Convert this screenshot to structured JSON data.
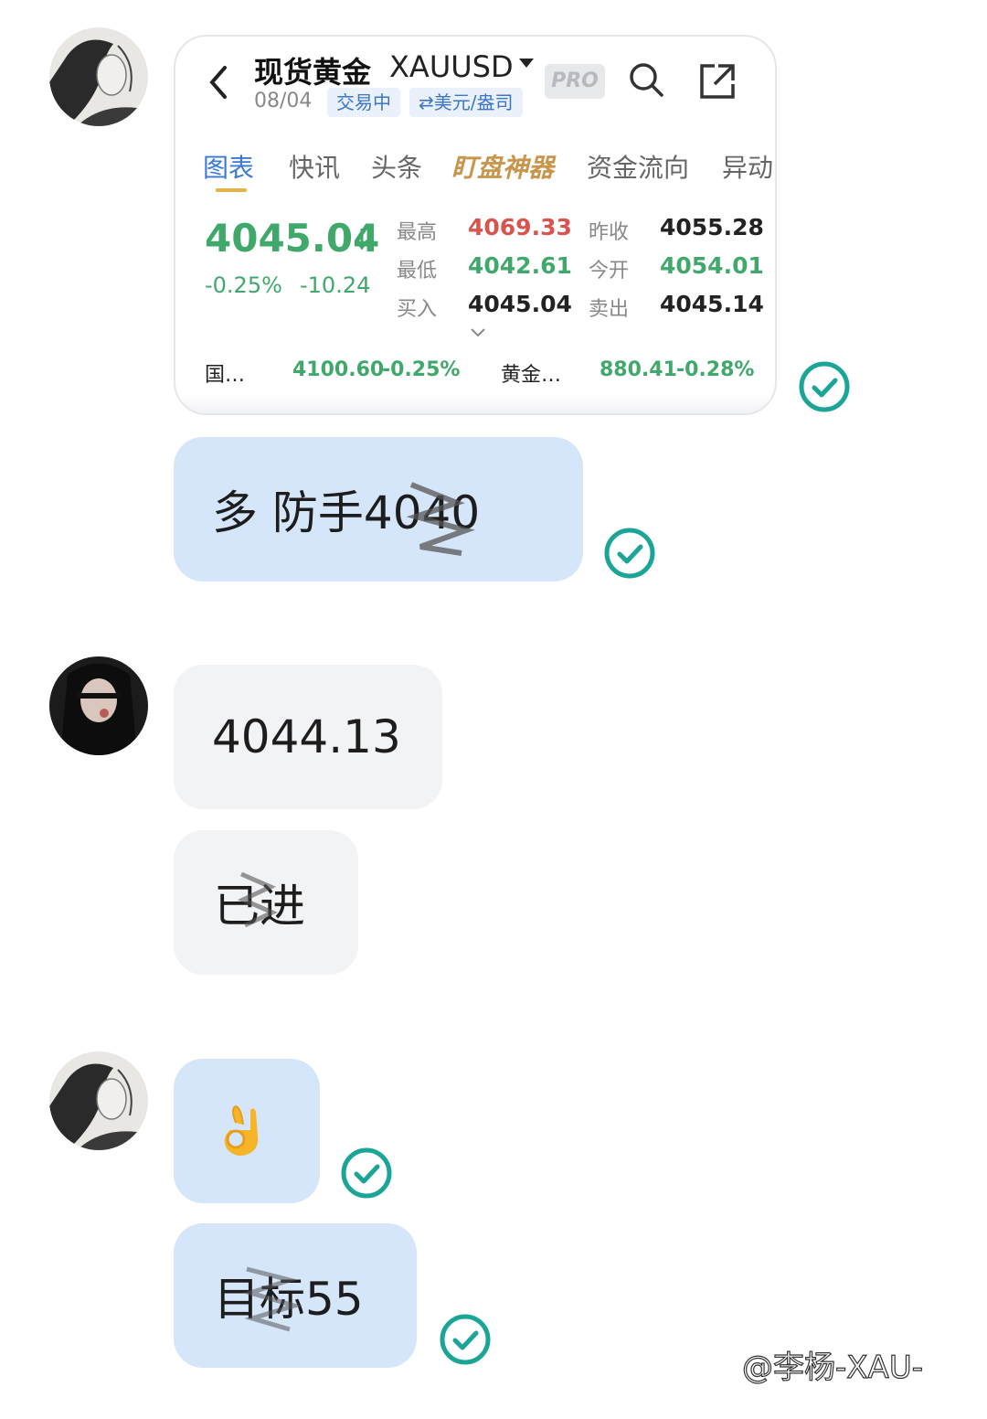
{
  "quote_card": {
    "title": "现货黄金",
    "symbol": "XAUUSD",
    "pro_badge": "PRO",
    "date": "08/04",
    "status_tag": "交易中",
    "currency_tag": "⇄美元/盎司",
    "tabs": [
      "图表",
      "快讯",
      "头条",
      "盯盘神器",
      "资金流向",
      "异动"
    ],
    "price": "4045.04",
    "change_pct": "-0.25%",
    "change_abs": "-10.24",
    "high_label": "最高",
    "high_value": "4069.33",
    "low_label": "最低",
    "low_value": "4042.61",
    "bid_label": "买入",
    "bid_value": "4045.04",
    "prev_close_label": "昨收",
    "prev_close_value": "4055.28",
    "open_label": "今开",
    "open_value": "4054.01",
    "ask_label": "卖出",
    "ask_value": "4045.14",
    "related": [
      {
        "name": "国…",
        "value": "4100.60",
        "change": "-0.25%"
      },
      {
        "name": "黄金…",
        "value": "880.41",
        "change": "-0.28%"
      }
    ]
  },
  "messages": [
    {
      "sender": "me",
      "text": "多 防手4040"
    },
    {
      "sender": "other",
      "text": "4044.13"
    },
    {
      "sender": "other",
      "text": "已进"
    },
    {
      "sender": "me",
      "text": "👌"
    },
    {
      "sender": "me",
      "text": "目标55"
    }
  ],
  "watermark": "@李杨-XAU-",
  "colors": {
    "my_bubble": "#d5e6fb",
    "other_bubble": "#f2f3f5",
    "read_check": "#1aa597",
    "up_red": "#d9534f",
    "down_green": "#3fa86a",
    "tab_active": "#3a79d4"
  }
}
